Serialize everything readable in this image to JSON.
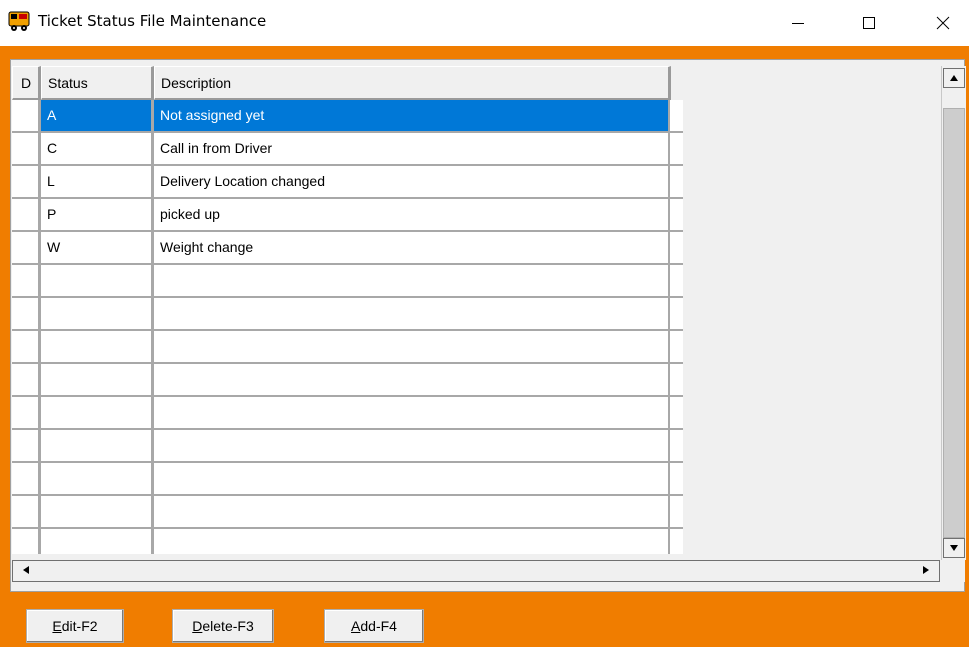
{
  "window": {
    "title": "Ticket Status File Maintenance",
    "minimize_icon": "minimize-icon",
    "maximize_icon": "maximize-icon",
    "close_icon": "close-icon",
    "accent_color": "#f07d00",
    "selection_color": "#0078d7"
  },
  "grid": {
    "columns": [
      "D",
      "Status",
      "Description"
    ],
    "rows": [
      {
        "d": "",
        "status": "A",
        "description": "Not assigned yet",
        "selected": true
      },
      {
        "d": "",
        "status": "C",
        "description": "Call in from Driver",
        "selected": false
      },
      {
        "d": "",
        "status": "L",
        "description": "Delivery Location changed",
        "selected": false
      },
      {
        "d": "",
        "status": "P",
        "description": "picked up",
        "selected": false
      },
      {
        "d": "",
        "status": "W",
        "description": "Weight change",
        "selected": false
      },
      {
        "d": "",
        "status": "",
        "description": "",
        "selected": false
      },
      {
        "d": "",
        "status": "",
        "description": "",
        "selected": false
      },
      {
        "d": "",
        "status": "",
        "description": "",
        "selected": false
      },
      {
        "d": "",
        "status": "",
        "description": "",
        "selected": false
      },
      {
        "d": "",
        "status": "",
        "description": "",
        "selected": false
      },
      {
        "d": "",
        "status": "",
        "description": "",
        "selected": false
      },
      {
        "d": "",
        "status": "",
        "description": "",
        "selected": false
      },
      {
        "d": "",
        "status": "",
        "description": "",
        "selected": false
      },
      {
        "d": "",
        "status": "",
        "description": "",
        "selected": false
      }
    ]
  },
  "buttons": {
    "edit": {
      "accel": "E",
      "rest": "dit-F2"
    },
    "delete": {
      "accel": "D",
      "rest": "elete-F3"
    },
    "add": {
      "accel": "A",
      "rest": "dd-F4"
    }
  }
}
